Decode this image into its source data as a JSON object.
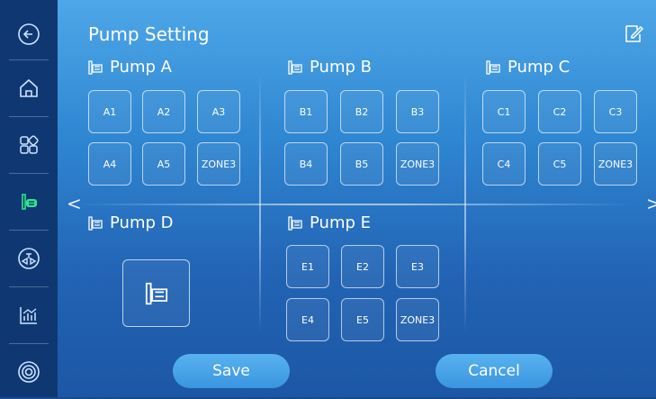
{
  "page": {
    "title": "Pump Setting"
  },
  "sidebar": {
    "items": [
      {
        "icon": "back-arrow-icon"
      },
      {
        "icon": "home-icon"
      },
      {
        "icon": "grid-icon"
      },
      {
        "icon": "pump-icon",
        "active": true
      },
      {
        "icon": "valve-icon"
      },
      {
        "icon": "chart-icon"
      },
      {
        "icon": "target-icon"
      }
    ]
  },
  "pumps": [
    {
      "name": "Pump A",
      "zones": [
        "A1",
        "A2",
        "A3",
        "A4",
        "A5",
        "ZONE3"
      ]
    },
    {
      "name": "Pump B",
      "zones": [
        "B1",
        "B2",
        "B3",
        "B4",
        "B5",
        "ZONE3"
      ]
    },
    {
      "name": "Pump C",
      "zones": [
        "C1",
        "C2",
        "C3",
        "C4",
        "C5",
        "ZONE3"
      ]
    },
    {
      "name": "Pump D",
      "zones": []
    },
    {
      "name": "Pump E",
      "zones": [
        "E1",
        "E2",
        "E3",
        "E4",
        "E5",
        "ZONE3"
      ]
    }
  ],
  "actions": {
    "save_label": "Save",
    "cancel_label": "Cancel"
  },
  "navigation": {
    "prev": "<",
    "next": ">"
  },
  "colors": {
    "accent": "#3a95df",
    "sidebar": "#0f3873",
    "active_icon": "#2ee68a"
  }
}
